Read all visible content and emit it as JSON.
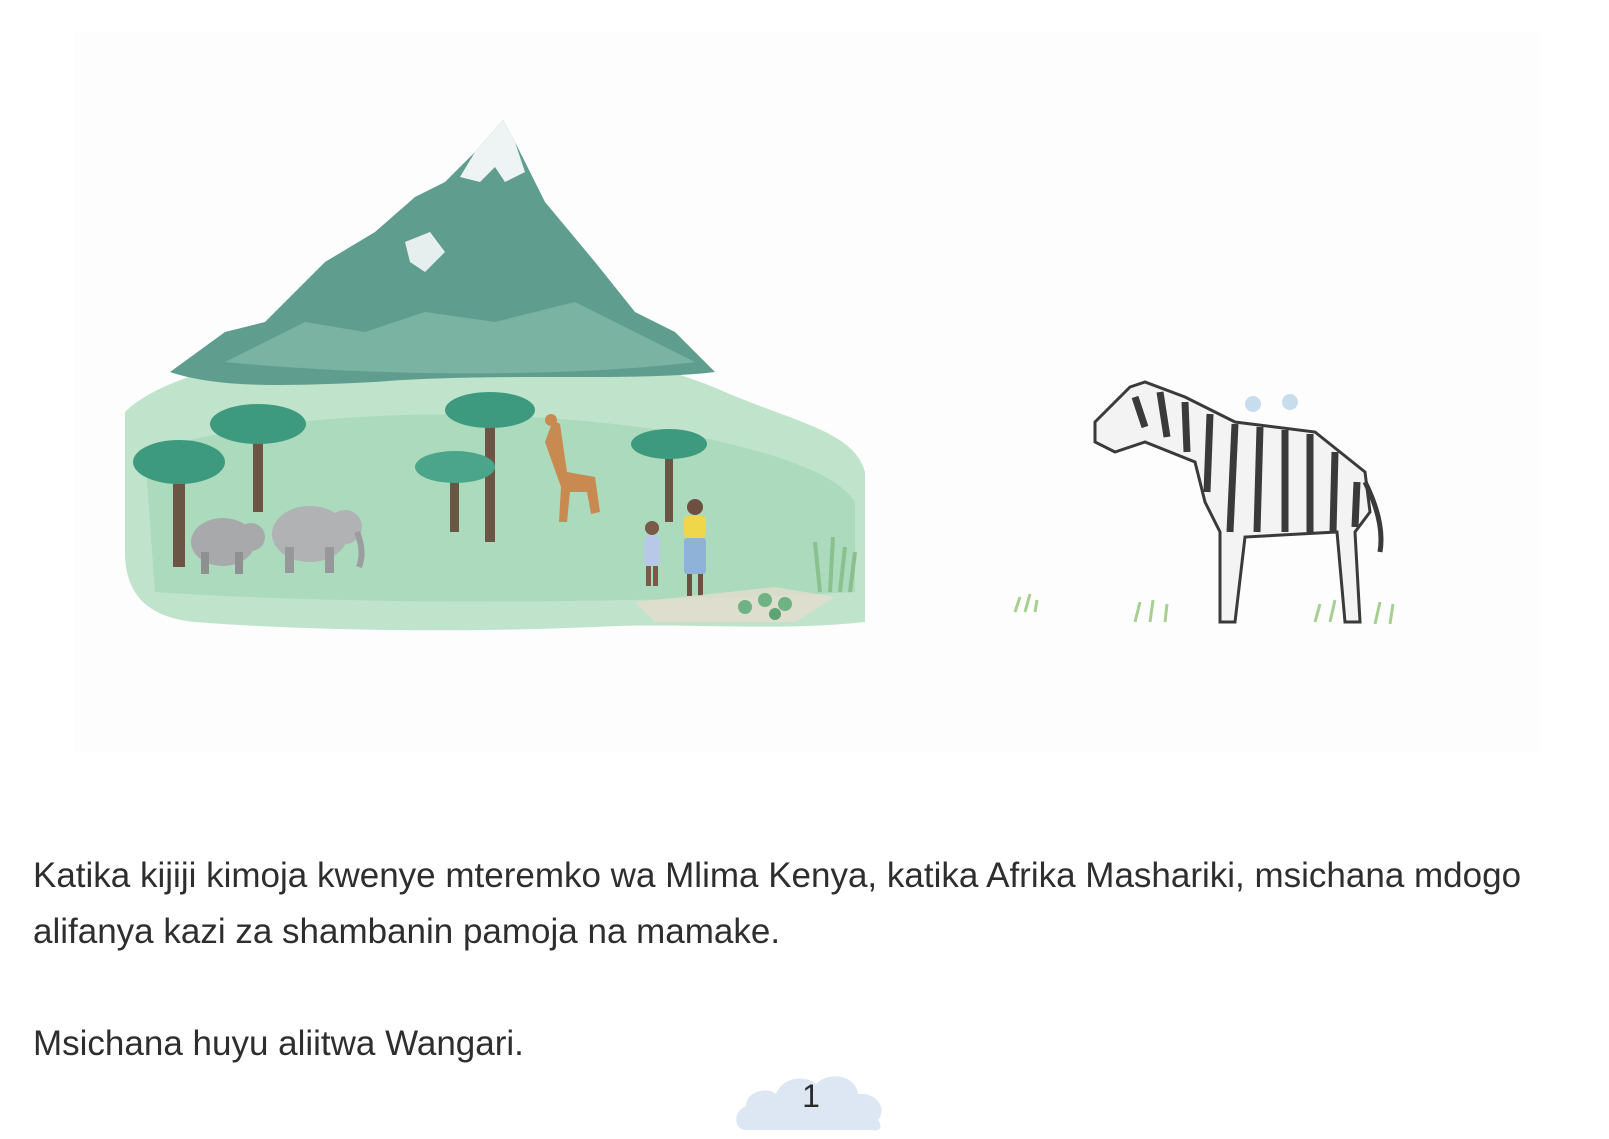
{
  "story": {
    "paragraph_1": "Katika kijiji kimoja kwenye mteremko wa Mlima Kenya, katika Afrika Mashariki, msichana mdogo alifanya kazi za shambanin pamoja na mamake.",
    "paragraph_2": "Msichana huyu aliitwa Wangari."
  },
  "page_number": "1",
  "colors": {
    "mountain": "#5f9e8f",
    "grass": "#9fd3b4",
    "tree_canopy": "#3e9a7f",
    "tree_trunk": "#6b5544",
    "elephant": "#a7a9ab",
    "giraffe": "#c98a52",
    "zebra_stripe": "#3a3a3a",
    "page_cloud": "#dde6f3",
    "text": "#2e2e2e"
  }
}
